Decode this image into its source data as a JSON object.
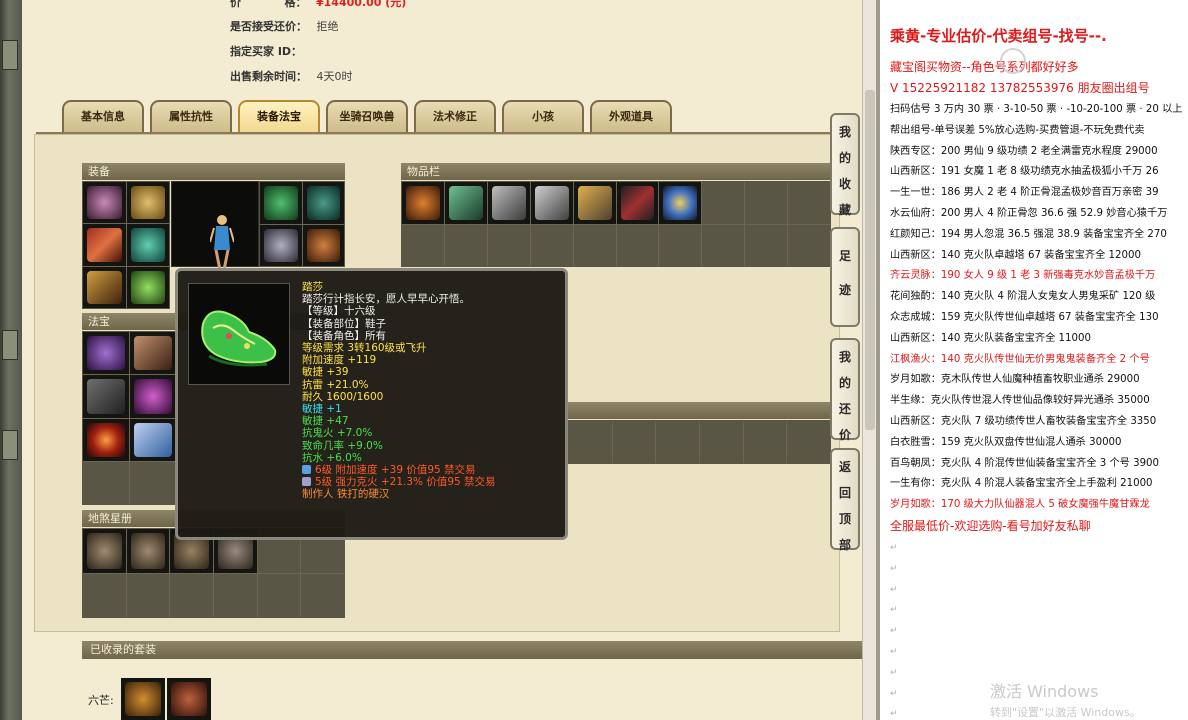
{
  "listing": {
    "price_label": "价",
    "price_label2": "格：",
    "price_value": "¥14400.00 (元)",
    "bargain_label": "是否接受还价：",
    "bargain_value": "拒绝",
    "buyer_label": "指定买家 ID：",
    "buyer_value": "",
    "time_label": "出售剩余时间：",
    "time_value": "4天0时"
  },
  "tabs": [
    "基本信息",
    "属性抗性",
    "装备法宝",
    "坐骑召唤兽",
    "法术修正",
    "小孩",
    "外观道具"
  ],
  "active_tab": 2,
  "sections": {
    "equipment": "装备",
    "inventory": "物品栏",
    "treasure": "法宝",
    "star_book": "地煞星册",
    "collected_sets": "已收录的套装",
    "set_label": "六芒:"
  },
  "tooltip": {
    "name": "踏莎",
    "desc": "踏莎行计指长安，愿人早早心开悟。",
    "level": "【等级】十六级",
    "slot": "【装备部位】鞋子",
    "role": "【装备角色】所有",
    "req": "等级需求  3转160级或飞升",
    "speed": "附加速度 +119",
    "agi": "敏捷 +39",
    "res_thunder": "抗雷 +21.0%",
    "durability": "耐久 1600/1600",
    "agi2": "敏捷 +1",
    "agi3": "敏捷 +47",
    "res_ghost": "抗鬼火 +7.0%",
    "crit": "致命几率 +9.0%",
    "res_water": "抗水 +6.0%",
    "gem1": "6级 附加速度 +39 价值95 禁交易",
    "gem2": "5级 强力克火 +21.3% 价值95 禁交易",
    "maker": "制作人 铁打的硬汉"
  },
  "side_buttons": {
    "fav": [
      "我",
      "的",
      "收",
      "藏"
    ],
    "trace": [
      "足",
      "迹"
    ],
    "bargain": [
      "我",
      "的",
      "还",
      "价"
    ],
    "top": [
      "返",
      "回",
      "顶",
      "部"
    ]
  },
  "editor": {
    "title": "乘黄-专业估价-代卖组号-找号--.",
    "subtitle": "藏宝阁买物资--角色号系列都好好多",
    "phone": "V 15225921182   13782553976 朋友圈出组号",
    "lines": [
      {
        "text": "扫码估号 3 万内 30 票 · 3-10-50 票 · -10-20-100 票 · 20 以上",
        "red": false
      },
      {
        "text": "帮出组号-单号误差 5%放心选购-买费管退-不玩免费代卖",
        "red": false
      },
      {
        "text": "陕西专区：200 男仙 9 级功绩 2 老全满雷克水程度 29000",
        "red": false
      },
      {
        "text": "山西新区：191 女魔 1 老 8 级功绩克水抽孟极狐小千万 26",
        "red": false
      },
      {
        "text": "一生一世：186 男人 2 老 4 阶正骨混孟极妙音百万亲密 39",
        "red": false
      },
      {
        "text": "水云仙府：200 男人 4 阶正骨忽 36.6 强 52.9 妙音心猿千万",
        "red": false
      },
      {
        "text": "红颜知己：194 男人忽混 36.5 强混 38.9 装备宝宝齐全 270",
        "red": false
      },
      {
        "text": "山西新区：140 克火队卓越塔 67 装备宝宝齐全 12000",
        "red": false
      },
      {
        "text": "齐云灵脉：190 女人 9 级 1 老 3 新强毒克水妙音孟极千万",
        "red": true
      },
      {
        "text": "花间独酌：140 克火队 4 阶混人女鬼女人男鬼采矿 120 级",
        "red": false
      },
      {
        "text": "众志成城：159 克火队传世仙卓越塔 67 装备宝宝齐全 130",
        "red": false
      },
      {
        "text": "山西新区：140 克火队装备宝宝齐全 11000",
        "red": false
      },
      {
        "text": "江枫渔火：140 克火队传世仙无价男鬼鬼装备齐全 2 个号",
        "red": true
      },
      {
        "text": "岁月如歌：克木队传世人仙魔种植畜牧职业通杀 29000",
        "red": false
      },
      {
        "text": "半生缘：克火队传世混人传世仙品像较好异光通杀 35000",
        "red": false
      },
      {
        "text": "山西新区：克火队 7 级功绩传世人畜牧装备宝宝齐全 3350",
        "red": false
      },
      {
        "text": "白衣胜雪：159 克火队双盘传世仙混人通杀 30000",
        "red": false
      },
      {
        "text": "百鸟朝凤：克火队 4 阶混传世仙装备宝宝齐全 3 个号 3900",
        "red": false
      },
      {
        "text": "一生有你：克火队 4 阶混人装备宝宝齐全上手盈利 21000",
        "red": false
      },
      {
        "text": "岁月如歌：170 级大力队仙器混人 5 破女魔强牛魔甘霖龙",
        "red": true
      },
      {
        "text": "全服最低价-欢迎选购-看号加好友私聊",
        "red": true,
        "big": true
      }
    ],
    "empty_mark": "↵"
  },
  "watermark": {
    "line1": "激活 Windows",
    "line2": "转到\"设置\"以激活 Windows。"
  },
  "colors": {
    "red_text": "#e01818",
    "tooltip_yellow": "#ffe14a",
    "tooltip_green": "#49e04a",
    "tooltip_cyan": "#37e0e8",
    "panel_bg": "#ece3c4"
  }
}
